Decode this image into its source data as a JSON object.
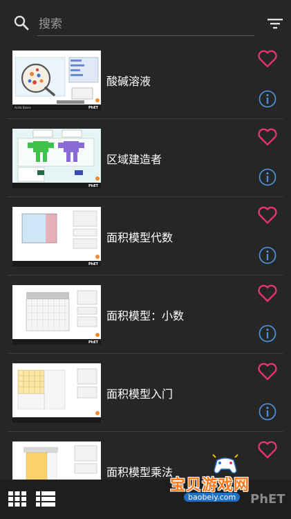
{
  "search": {
    "placeholder": "搜索",
    "value": ""
  },
  "icons": {
    "search": "search-icon",
    "filter": "filter-icon",
    "favorite": "heart-icon",
    "info": "info-icon",
    "grid_view": "grid-view-icon",
    "list_view": "list-view-icon"
  },
  "colors": {
    "background": "#262626",
    "heart": "#e8336f",
    "info": "#4a8fd4",
    "bottom_bar": "#1e1e1e"
  },
  "sims": [
    {
      "title": "酸碱溶液",
      "thumbnail": "acid-base-thumbnail"
    },
    {
      "title": "区域建造者",
      "thumbnail": "area-builder-thumbnail"
    },
    {
      "title": "面积模型代数",
      "thumbnail": "area-model-algebra-thumbnail"
    },
    {
      "title": "面积模型：小数",
      "thumbnail": "area-model-decimals-thumbnail"
    },
    {
      "title": "面积模型入门",
      "thumbnail": "area-model-intro-thumbnail"
    },
    {
      "title": "面积模型乘法",
      "thumbnail": "area-model-multiplication-thumbnail"
    }
  ],
  "watermark": {
    "name": "宝贝游戏网",
    "url": "baobeiy.com",
    "brand": "PhET"
  }
}
